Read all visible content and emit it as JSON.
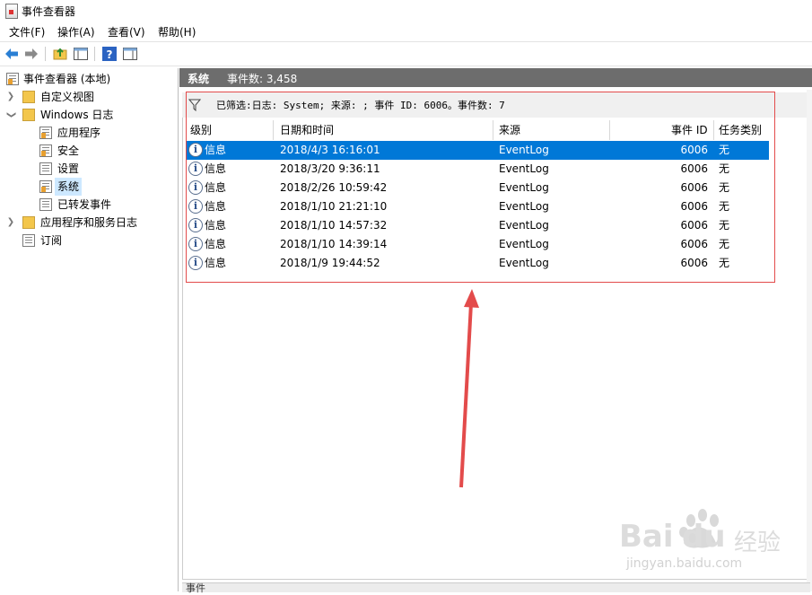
{
  "window": {
    "title": "事件查看器"
  },
  "menu": [
    "文件(F)",
    "操作(A)",
    "查看(V)",
    "帮助(H)"
  ],
  "toolbar": {
    "icons": [
      "back-arrow-icon",
      "forward-arrow-icon",
      "folder-up-icon",
      "show-hide-tree-icon",
      "help-icon",
      "action-pane-icon"
    ]
  },
  "tree": {
    "root": "事件查看器 (本地)",
    "custom_views": "自定义视图",
    "windows_logs": "Windows 日志",
    "application": "应用程序",
    "security": "安全",
    "setup": "设置",
    "system": "系统",
    "forwarded": "已转发事件",
    "app_service_logs": "应用程序和服务日志",
    "subscriptions": "订阅"
  },
  "pane": {
    "title": "系统",
    "event_count": "事件数: 3,458",
    "filter_text": "已筛选:日志: System; 来源: ; 事件 ID: 6006。事件数: 7"
  },
  "columns": {
    "level": "级别",
    "datetime": "日期和时间",
    "source": "来源",
    "event_id": "事件 ID",
    "task_category": "任务类别"
  },
  "rows": [
    {
      "level": "信息",
      "datetime": "2018/4/3 16:16:01",
      "source": "EventLog",
      "event_id": "6006",
      "task": "无"
    },
    {
      "level": "信息",
      "datetime": "2018/3/20 9:36:11",
      "source": "EventLog",
      "event_id": "6006",
      "task": "无"
    },
    {
      "level": "信息",
      "datetime": "2018/2/26 10:59:42",
      "source": "EventLog",
      "event_id": "6006",
      "task": "无"
    },
    {
      "level": "信息",
      "datetime": "2018/1/10 21:21:10",
      "source": "EventLog",
      "event_id": "6006",
      "task": "无"
    },
    {
      "level": "信息",
      "datetime": "2018/1/10 14:57:32",
      "source": "EventLog",
      "event_id": "6006",
      "task": "无"
    },
    {
      "level": "信息",
      "datetime": "2018/1/10 14:39:14",
      "source": "EventLog",
      "event_id": "6006",
      "task": "无"
    },
    {
      "level": "信息",
      "datetime": "2018/1/9 19:44:52",
      "source": "EventLog",
      "event_id": "6006",
      "task": "无"
    }
  ],
  "bottom": {
    "label": "事件"
  },
  "watermark": {
    "brand": "Bai",
    "brand2": "du",
    "brand_cn": "经验",
    "url": "jingyan.baidu.com"
  },
  "colors": {
    "selection": "#0078d7",
    "annotation_red": "#e34b4b",
    "header_gray": "#6d6d6d"
  }
}
